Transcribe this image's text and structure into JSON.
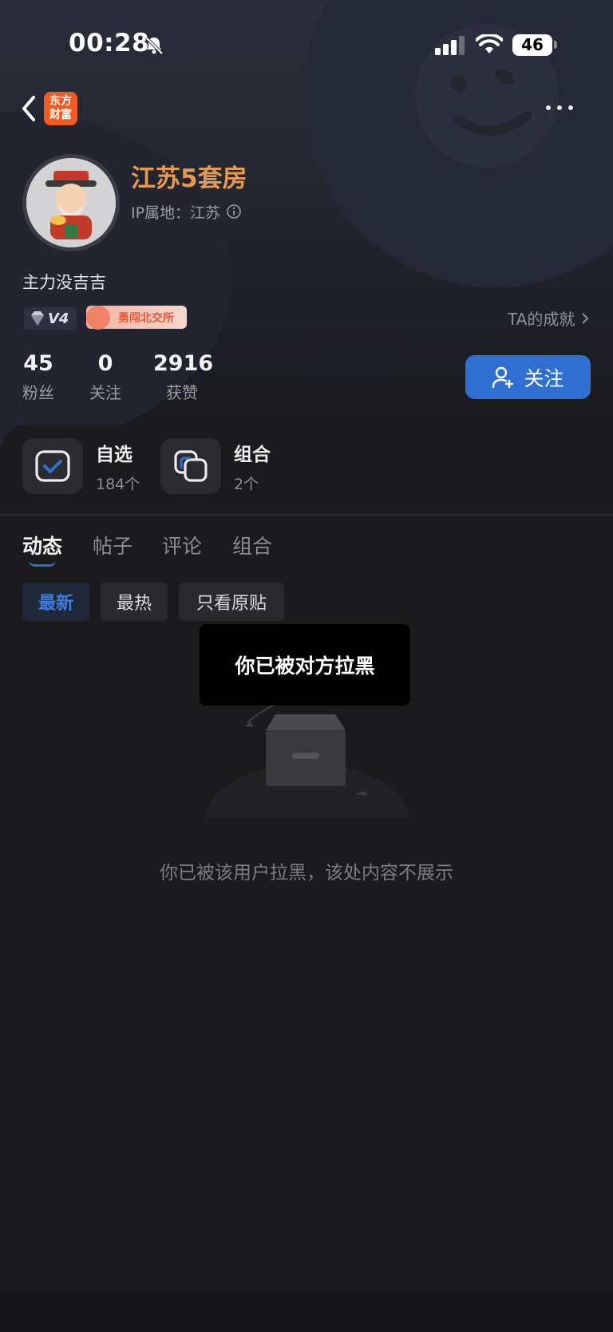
{
  "status_bar": {
    "time": "00:28",
    "battery": "46"
  },
  "nav": {
    "logo_line1": "东方",
    "logo_line2": "财富"
  },
  "profile": {
    "username": "江苏5套房",
    "ip_location": "IP属地：江苏",
    "bio": "主力没吉吉",
    "badge_level": "V4",
    "badge_medal": "勇闯北交所",
    "achievement_link": "TA的成就"
  },
  "stats": [
    {
      "value": "45",
      "label": "粉丝"
    },
    {
      "value": "0",
      "label": "关注"
    },
    {
      "value": "2916",
      "label": "获赞"
    }
  ],
  "follow_button": "关注",
  "shortcuts": [
    {
      "title": "自选",
      "sub": "184个"
    },
    {
      "title": "组合",
      "sub": "2个"
    }
  ],
  "tabs": [
    "动态",
    "帖子",
    "评论",
    "组合"
  ],
  "filters": [
    "最新",
    "最热",
    "只看原贴"
  ],
  "empty_message": "你已被该用户拉黑，该处内容不展示",
  "toast": "你已被对方拉黑",
  "colors": {
    "accent": "#2f6fd1",
    "username": "#e49a54",
    "logo": "#f05a24"
  }
}
